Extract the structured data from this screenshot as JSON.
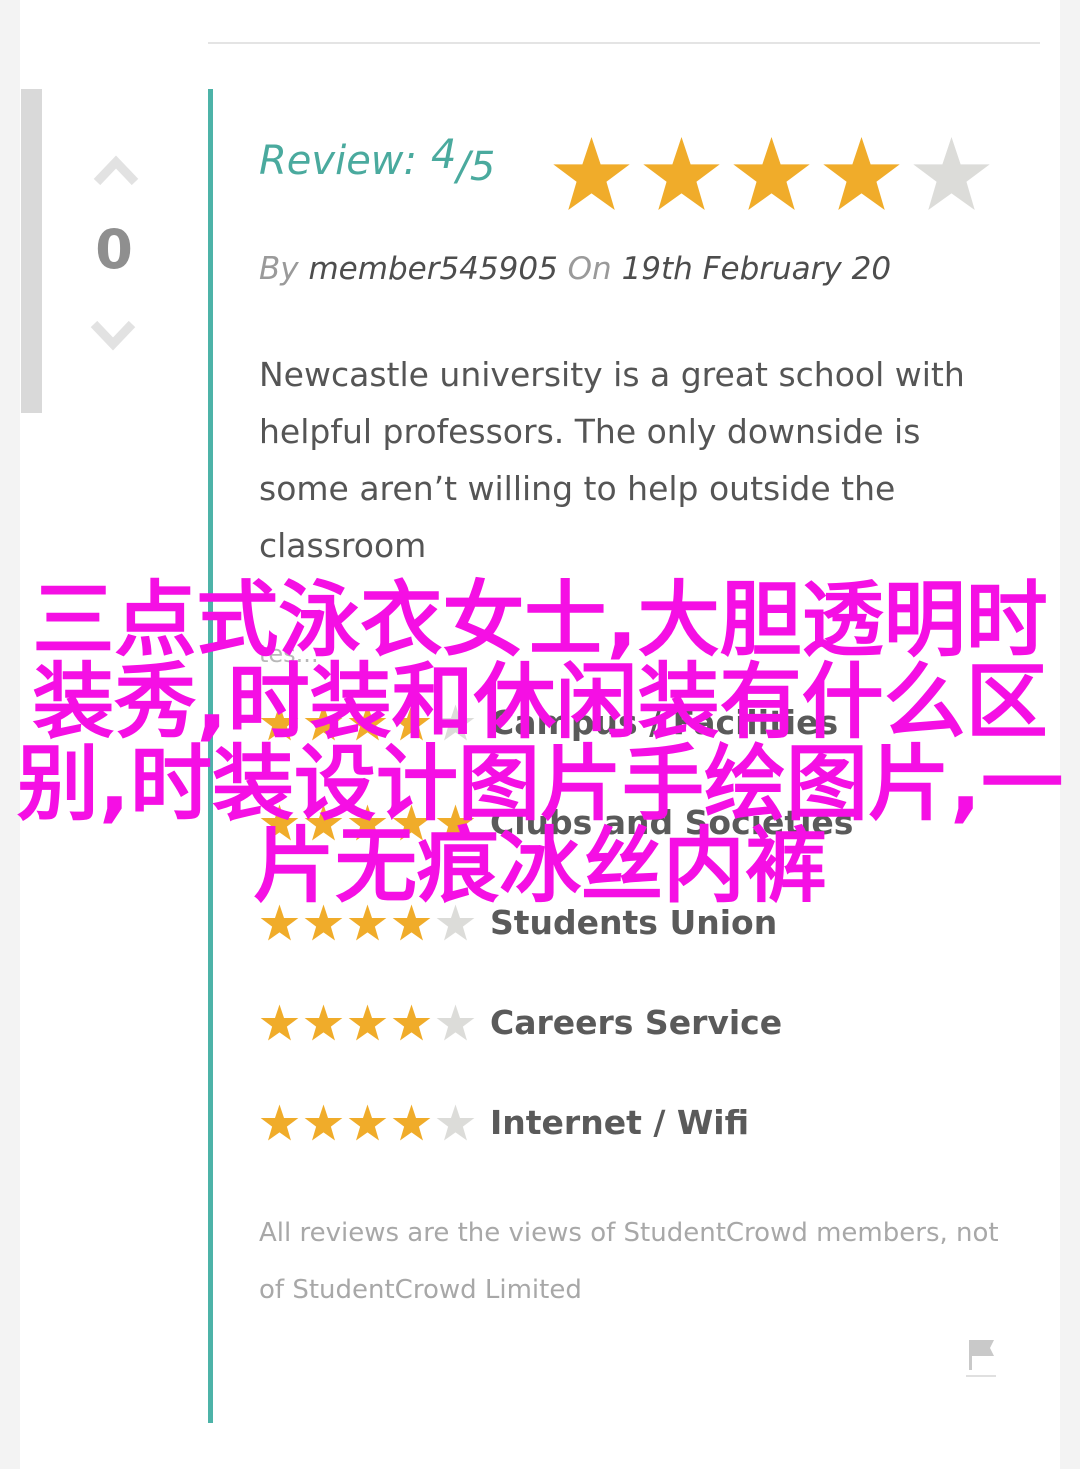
{
  "vote": {
    "count": "0"
  },
  "review": {
    "label": "Review:",
    "score": "4",
    "out_of": "/5",
    "rating": 4,
    "max_rating": 5,
    "by_label": "By",
    "author": "member545905",
    "on_label": "On",
    "date": "19th February 20",
    "text": "Newcastle university is a great school with helpful professors. The only downside is some aren’t willing to help outside the classroom"
  },
  "faded_text": "tes...",
  "categories": [
    {
      "label": "Campus / Facilities",
      "rating": 4
    },
    {
      "label": "Clubs and Societies",
      "rating": 5
    },
    {
      "label": "Students Union",
      "rating": 4
    },
    {
      "label": "Careers Service",
      "rating": 4
    },
    {
      "label": "Internet / Wifi",
      "rating": 4
    }
  ],
  "disclaimer": "All reviews are the views of StudentCrowd members, not of StudentCrowd Limited",
  "overlay_text": "三点式泳衣女士,大胆透明时装秀,时装和休闲装有什么区别,时装设计图片手绘图片,一片无痕冰丝内裤",
  "colors": {
    "star_filled": "#f0ac2a",
    "star_empty": "#dcdcd9",
    "accent": "#4db3a8",
    "overlay": "#f50fe4"
  },
  "icons": {
    "up": "chevron-up-icon",
    "down": "chevron-down-icon",
    "flag": "flag-icon",
    "star": "star-icon"
  }
}
